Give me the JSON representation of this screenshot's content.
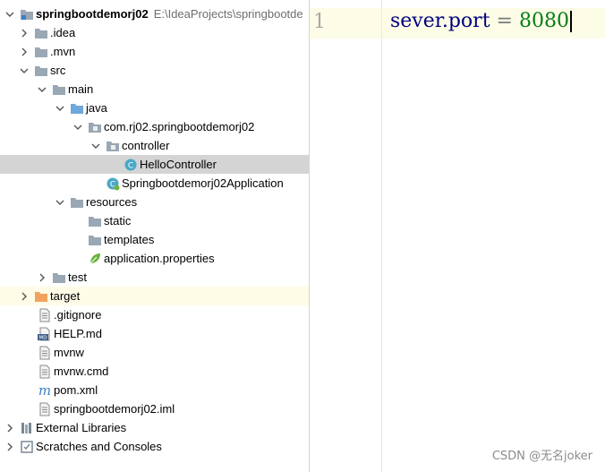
{
  "project": {
    "root": {
      "name": "springbootdemorj02",
      "path": "E:\\IdeaProjects\\springbootde"
    },
    "items": [
      {
        "label": ".idea"
      },
      {
        "label": ".mvn"
      },
      {
        "label": "src"
      },
      {
        "label": "main"
      },
      {
        "label": "java"
      },
      {
        "label": "com.rj02.springbootdemorj02"
      },
      {
        "label": "controller"
      },
      {
        "label": "HelloController"
      },
      {
        "label": "Springbootdemorj02Application"
      },
      {
        "label": "resources"
      },
      {
        "label": "static"
      },
      {
        "label": "templates"
      },
      {
        "label": "application.properties"
      },
      {
        "label": "test"
      },
      {
        "label": "target"
      },
      {
        "label": ".gitignore"
      },
      {
        "label": "HELP.md"
      },
      {
        "label": "mvnw"
      },
      {
        "label": "mvnw.cmd"
      },
      {
        "label": "pom.xml"
      },
      {
        "label": "springbootdemorj02.iml"
      },
      {
        "label": "External Libraries"
      },
      {
        "label": "Scratches and Consoles"
      }
    ]
  },
  "editor": {
    "line_number": "1",
    "key": "sever.port",
    "equals": "=",
    "value": "8080"
  },
  "watermark": "CSDN @无名joker",
  "colors": {
    "selected_row": "#d4d4d4",
    "highlight_row": "#fefce7",
    "folder": "#9aa7b4",
    "source_folder": "#6fa8dc",
    "excluded_folder": "#f0a35e",
    "class_icon": "#4aa8c8",
    "spring": "#6db33f",
    "property_key": "#000080",
    "property_value": "#067d17"
  }
}
